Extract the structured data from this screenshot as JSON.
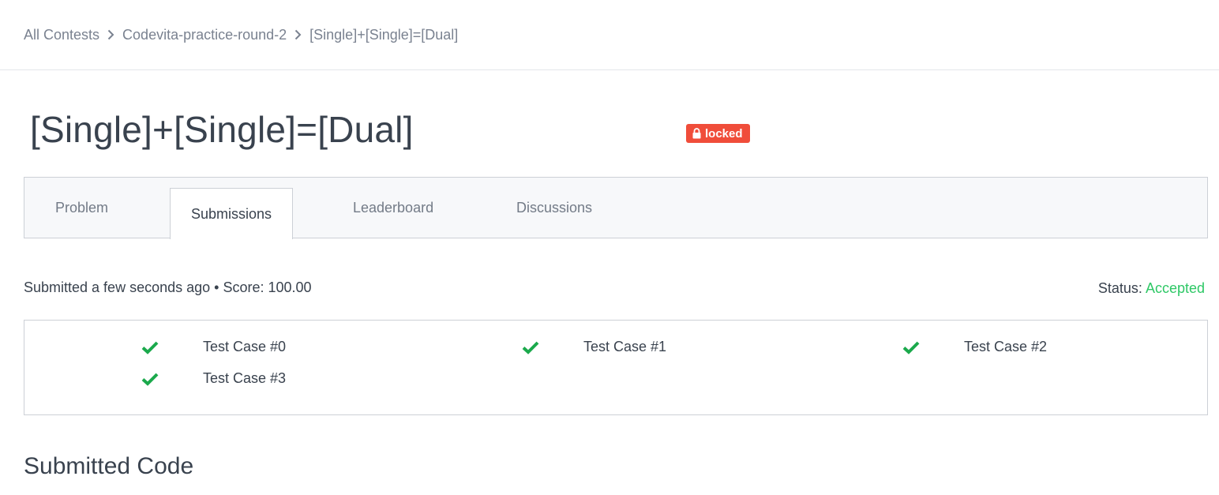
{
  "breadcrumb": {
    "items": [
      "All Contests",
      "Codevita-practice-round-2",
      "[Single]+[Single]=[Dual]"
    ]
  },
  "challenge": {
    "title": "[Single]+[Single]=[Dual]",
    "badge": "locked"
  },
  "tabs": [
    {
      "label": "Problem",
      "active": false
    },
    {
      "label": "Submissions",
      "active": true
    },
    {
      "label": "Leaderboard",
      "active": false
    },
    {
      "label": "Discussions",
      "active": false
    }
  ],
  "submission": {
    "meta": "Submitted a few seconds ago • Score: 100.00",
    "status_label": "Status:",
    "status_value": "Accepted"
  },
  "test_cases": [
    {
      "label": "Test Case #0",
      "passed": true
    },
    {
      "label": "Test Case #1",
      "passed": true
    },
    {
      "label": "Test Case #2",
      "passed": true
    },
    {
      "label": "Test Case #3",
      "passed": true
    }
  ],
  "code_section": {
    "title": "Submitted Code"
  },
  "colors": {
    "accepted": "#2ec866",
    "locked_badge": "#f04d3a",
    "check": "#1ba94c"
  },
  "icons": [
    "chevron-right-icon",
    "lock-icon",
    "check-icon"
  ]
}
